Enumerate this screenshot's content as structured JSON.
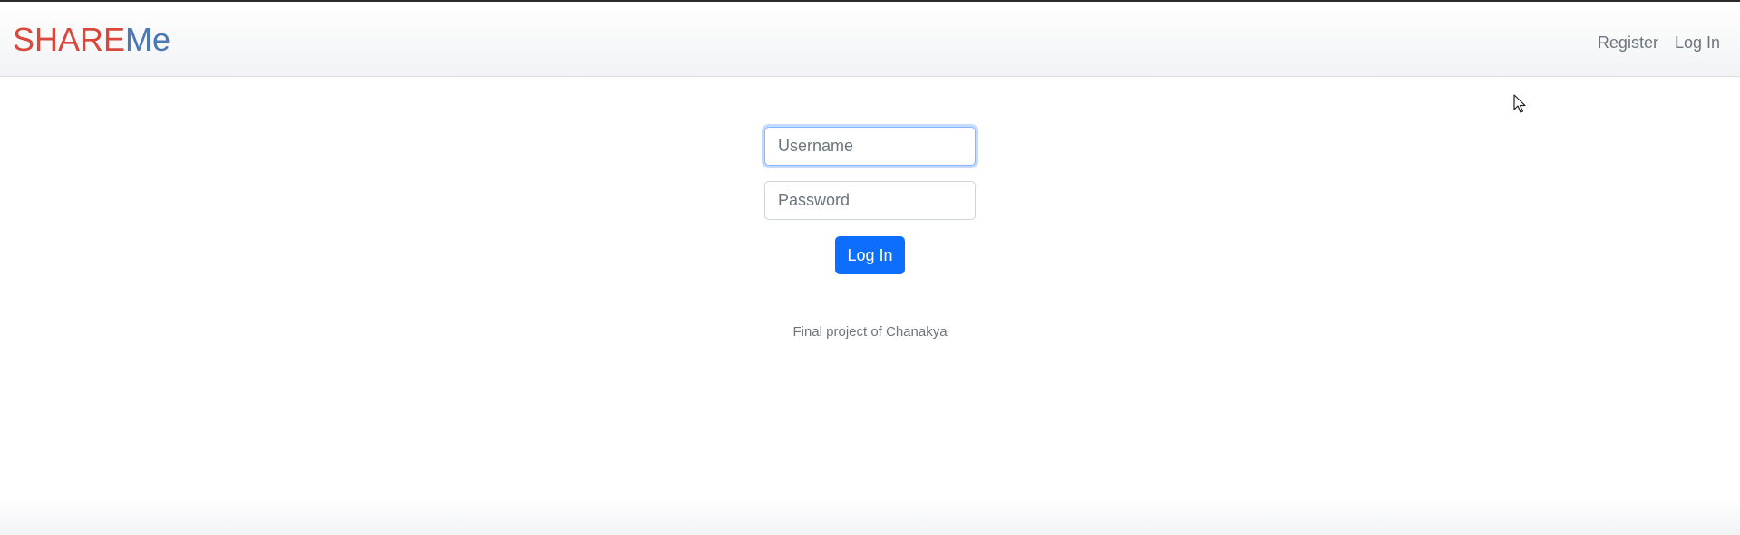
{
  "navbar": {
    "brand_part_a": "SHARE",
    "brand_part_b": "Me",
    "links": {
      "register": "Register",
      "login": "Log In"
    }
  },
  "login_form": {
    "username_placeholder": "Username",
    "password_placeholder": "Password",
    "submit_label": "Log In"
  },
  "footer": {
    "note": "Final project of Chanakya"
  },
  "colors": {
    "brand_red": "#d9483b",
    "brand_blue": "#4a78b5",
    "primary_button": "#0d6efd",
    "muted_text": "#6c757d"
  },
  "icons": {
    "cursor": "mouse-pointer-icon"
  }
}
